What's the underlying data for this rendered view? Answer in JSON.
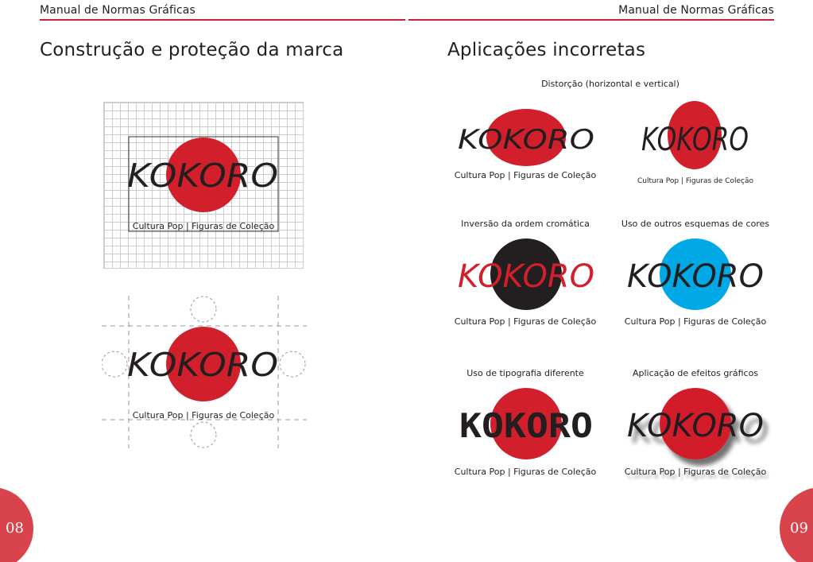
{
  "header": {
    "left": "Manual de Normas Gráficas",
    "right": "Manual de Normas Gráficas"
  },
  "page_left": {
    "title": "Construção e proteção da marca",
    "number": "08"
  },
  "page_right": {
    "title": "Aplicações incorretas",
    "number": "09",
    "sections": {
      "distortion": "Distorção (horizontal e vertical)",
      "inversion": "Inversão da ordem cromática",
      "colors": "Uso de outros esquemas de cores",
      "typography": "Uso de tipografia diferente",
      "effects": "Aplicação de efeitos gráficos"
    }
  },
  "logo": {
    "wordmark": "KOKORO",
    "tagline": "Cultura Pop | Figuras de Coleção"
  },
  "colors": {
    "brand_red": "#d21f2c",
    "black": "#231f20",
    "cyan": "#00a8e6",
    "rule": "#d21f2c"
  }
}
